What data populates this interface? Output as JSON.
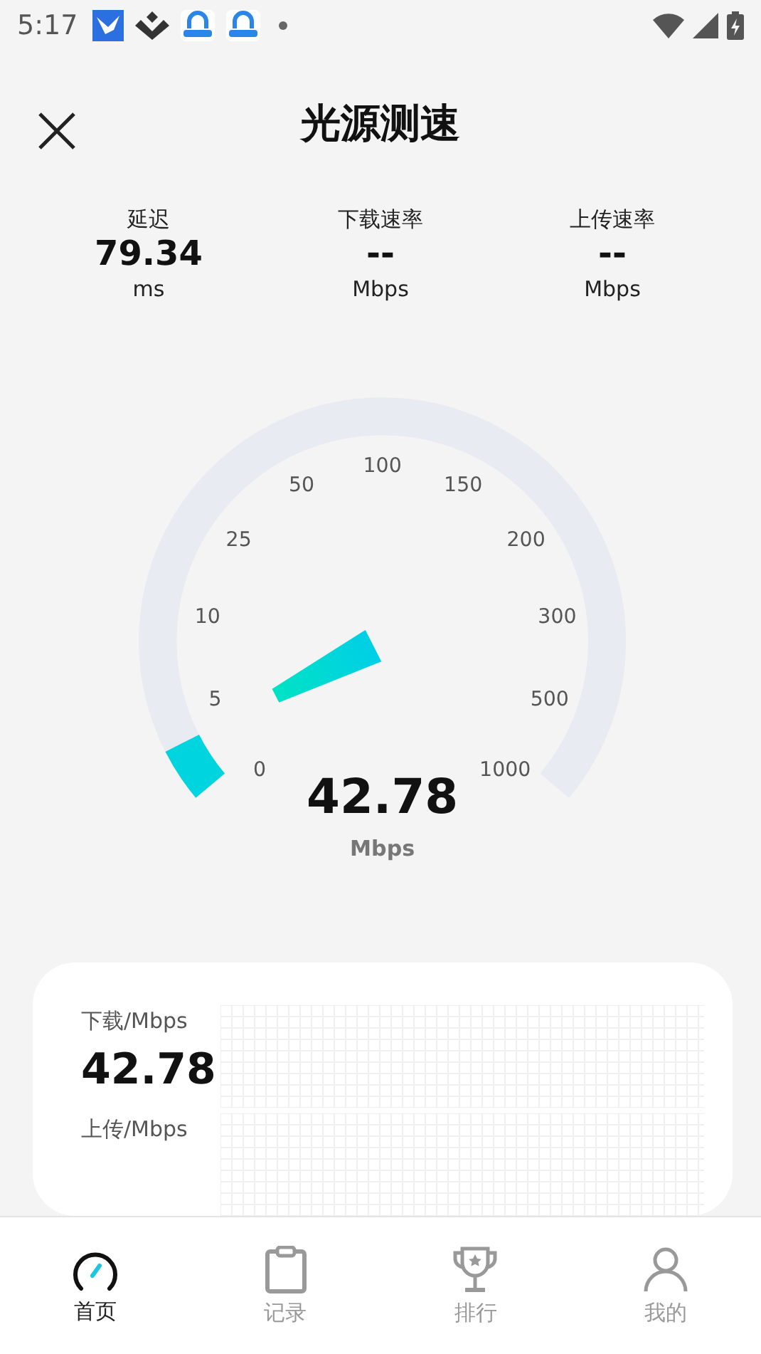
{
  "status_bar": {
    "time": "5:17"
  },
  "header": {
    "title": "光源测速"
  },
  "stats": [
    {
      "label": "延迟",
      "value": "79.34",
      "unit": "ms"
    },
    {
      "label": "下载速率",
      "value": "--",
      "unit": "Mbps"
    },
    {
      "label": "上传速率",
      "value": "--",
      "unit": "Mbps"
    }
  ],
  "gauge": {
    "ticks": [
      "0",
      "5",
      "10",
      "25",
      "50",
      "100",
      "150",
      "200",
      "300",
      "500",
      "1000"
    ],
    "value": "42.78",
    "unit": "Mbps"
  },
  "card": {
    "rows": [
      {
        "label": "下载/Mbps",
        "value": "42.78"
      },
      {
        "label": "上传/Mbps"
      }
    ]
  },
  "nav": [
    {
      "label": "首页",
      "kind": "speedometer",
      "selected": true
    },
    {
      "label": "记录",
      "kind": "clipboard",
      "selected": false
    },
    {
      "label": "排行",
      "kind": "trophy",
      "selected": false
    },
    {
      "label": "我的",
      "kind": "person",
      "selected": false
    }
  ]
}
